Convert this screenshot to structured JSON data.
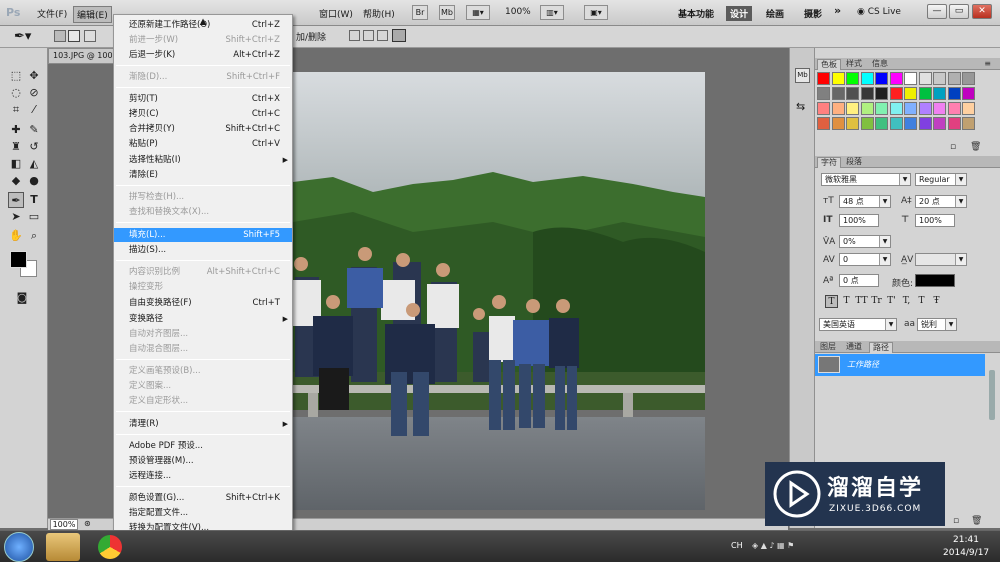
{
  "app": {
    "logo": "Ps"
  },
  "menubar": {
    "items": [
      "文件(F)",
      "编辑(E)",
      "窗口(W)",
      "帮助(H)"
    ],
    "buttons": [
      "Br",
      "Mb"
    ],
    "zoom": "100%",
    "workspaces": [
      "基本功能",
      "设计",
      "绘画",
      "摄影"
    ],
    "active_workspace": "设计",
    "more": "»",
    "cslive": "CS Live",
    "win_min": "—",
    "win_restore": "▭",
    "win_close": "✕"
  },
  "optionsbar": {
    "mode_label": "加/删除"
  },
  "document": {
    "tab": "103.JPG @ 100",
    "zoom_status": "100%"
  },
  "edit_menu": {
    "items": [
      {
        "label": "还原新建工作路径(O)",
        "shortcut": "Ctrl+Z",
        "enabled": true
      },
      {
        "label": "前进一步(W)",
        "shortcut": "Shift+Ctrl+Z",
        "enabled": false
      },
      {
        "label": "后退一步(K)",
        "shortcut": "Alt+Ctrl+Z",
        "enabled": true
      },
      {
        "label": "渐隐(D)...",
        "shortcut": "Shift+Ctrl+F",
        "enabled": false
      },
      {
        "label": "剪切(T)",
        "shortcut": "Ctrl+X",
        "enabled": true
      },
      {
        "label": "拷贝(C)",
        "shortcut": "Ctrl+C",
        "enabled": true
      },
      {
        "label": "合并拷贝(Y)",
        "shortcut": "Shift+Ctrl+C",
        "enabled": true
      },
      {
        "label": "粘贴(P)",
        "shortcut": "Ctrl+V",
        "enabled": true
      },
      {
        "label": "选择性粘贴(I)",
        "shortcut": "",
        "enabled": true,
        "submenu": true
      },
      {
        "label": "清除(E)",
        "shortcut": "",
        "enabled": true
      },
      {
        "label": "拼写检查(H)...",
        "shortcut": "",
        "enabled": false
      },
      {
        "label": "查找和替换文本(X)...",
        "shortcut": "",
        "enabled": false
      },
      {
        "label": "填充(L)...",
        "shortcut": "Shift+F5",
        "enabled": true,
        "highlighted": true
      },
      {
        "label": "描边(S)...",
        "shortcut": "",
        "enabled": true
      },
      {
        "label": "内容识别比例",
        "shortcut": "Alt+Shift+Ctrl+C",
        "enabled": false
      },
      {
        "label": "操控变形",
        "shortcut": "",
        "enabled": false
      },
      {
        "label": "自由变换路径(F)",
        "shortcut": "Ctrl+T",
        "enabled": true
      },
      {
        "label": "变换路径",
        "shortcut": "",
        "enabled": true,
        "submenu": true
      },
      {
        "label": "自动对齐图层...",
        "shortcut": "",
        "enabled": false
      },
      {
        "label": "自动混合图层...",
        "shortcut": "",
        "enabled": false
      },
      {
        "label": "定义画笔预设(B)...",
        "shortcut": "",
        "enabled": false
      },
      {
        "label": "定义图案...",
        "shortcut": "",
        "enabled": false
      },
      {
        "label": "定义自定形状...",
        "shortcut": "",
        "enabled": false
      },
      {
        "label": "清理(R)",
        "shortcut": "",
        "enabled": true,
        "submenu": true
      },
      {
        "label": "Adobe PDF 预设...",
        "shortcut": "",
        "enabled": true
      },
      {
        "label": "预设管理器(M)...",
        "shortcut": "",
        "enabled": true
      },
      {
        "label": "远程连接...",
        "shortcut": "",
        "enabled": true
      },
      {
        "label": "颜色设置(G)...",
        "shortcut": "Shift+Ctrl+K",
        "enabled": true
      },
      {
        "label": "指定配置文件...",
        "shortcut": "",
        "enabled": true
      },
      {
        "label": "转换为配置文件(V)...",
        "shortcut": "",
        "enabled": true
      }
    ],
    "scroll_up": "▲",
    "scroll_down": "▼"
  },
  "swatches_panel": {
    "tabs": [
      "色板",
      "样式",
      "信息"
    ],
    "colors": [
      "#ff0000",
      "#ffff00",
      "#00ff00",
      "#00ffff",
      "#0000ff",
      "#ff00ff",
      "#ffffff",
      "#e0e0e0",
      "#c8c8c8",
      "#b0b0b0",
      "#989898",
      "#808080",
      "#686868",
      "#505050",
      "#383838",
      "#202020",
      "#ff2020",
      "#f0f000",
      "#00c040",
      "#00a0c0",
      "#0040c0",
      "#c000c0",
      "#ff8080",
      "#ffb080",
      "#fff080",
      "#b0f080",
      "#80f0b0",
      "#80f0f0",
      "#80b0ff",
      "#b080ff",
      "#f080f0",
      "#ff80b0",
      "#ffd0a0",
      "#e06040",
      "#e09040",
      "#e0c040",
      "#80c040",
      "#40c080",
      "#40c0c0",
      "#4080e0",
      "#8040e0",
      "#c040c0",
      "#e04080",
      "#c0a070"
    ]
  },
  "character_panel": {
    "tabs": [
      "字符",
      "段落"
    ],
    "font_family": "微软雅黑",
    "font_style": "Regular",
    "font_size": "48 点",
    "leading": "20 点",
    "vertical_scale": "100%",
    "horizontal_scale": "100%",
    "tracking": "0%",
    "kerning": "0",
    "baseline_shift": "0 点",
    "color_label": "颜色:",
    "language": "美国英语",
    "antialias_icon": "aa",
    "antialias": "锐利",
    "style_buttons": [
      "T",
      "T",
      "TT",
      "Tr",
      "T'",
      "T,",
      "T",
      "Ŧ"
    ]
  },
  "paths_panel": {
    "tabs": [
      "图层",
      "通道",
      "路径"
    ],
    "active_tab": "路径",
    "items": [
      "工作路径"
    ]
  },
  "taskbar": {
    "ime": "CH",
    "time": "21:41",
    "date": "2014/9/17"
  },
  "watermark": {
    "brand": "溜溜自学",
    "url": "ZIXUE.3D66.COM"
  }
}
